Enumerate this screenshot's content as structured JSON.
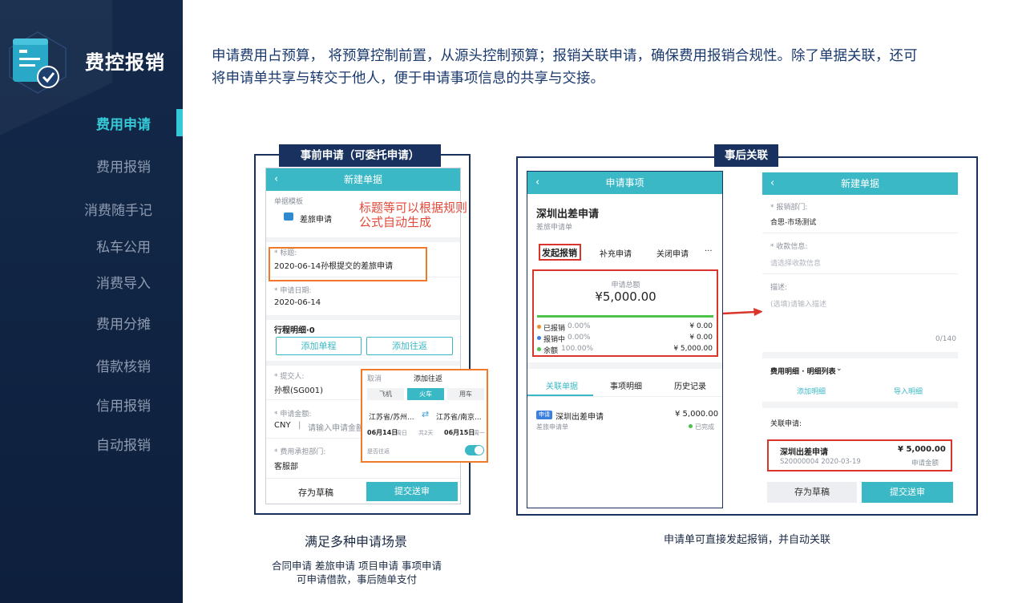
{
  "sidebar": {
    "brand": "费控报销",
    "items": [
      {
        "label": "费用申请",
        "active": true
      },
      {
        "label": "费用报销",
        "active": false
      },
      {
        "label": "消费随手记",
        "active": false
      },
      {
        "label": "私车公用",
        "active": false
      },
      {
        "label": "消费导入",
        "active": false
      },
      {
        "label": "费用分摊",
        "active": false
      },
      {
        "label": "借款核销",
        "active": false
      },
      {
        "label": "信用报销",
        "active": false
      },
      {
        "label": "自动报销",
        "active": false
      }
    ]
  },
  "description": "申请费用占预算， 将预算控制前置，从源头控制预算；报销关联申请，确保费用报销合规性。除了单据关联，还可将申请单共享与转交于他人，便于申请事项信息的共享与交接。",
  "colors": {
    "accent": "#35c8d6",
    "navy": "#18315e",
    "highlight_red": "#d9352b",
    "highlight_orange": "#f07a2a"
  },
  "left_panel": {
    "tag": "事前申请（可委托申请）",
    "annotation": [
      "标题等可以根据规则",
      "公式自动生成"
    ],
    "phone": {
      "header": "新建单据",
      "template_label": "单据模板",
      "template_value": "差旅申请",
      "title_label": "* 标题:",
      "title_value": "2020-06-14孙根提交的差旅申请",
      "date_label": "* 申请日期:",
      "date_value": "2020-06-14",
      "trip_label": "行程明细·0",
      "add_single": "添加单程",
      "add_return": "添加往返",
      "submitter_label": "* 提交人:",
      "submitter_value": "孙根(SG001)",
      "amount_label": "* 申请金额:",
      "currency": "CNY",
      "amount_placeholder": "请输入申请金额",
      "dept_label": "* 费用承担部门:",
      "dept_value": "客服部",
      "save_draft": "存为草稿",
      "submit": "提交送审"
    },
    "popup": {
      "cancel": "取消",
      "title": "添加往返",
      "modes": [
        "飞机",
        "火车",
        "用车"
      ],
      "active_mode": "火车",
      "from": "江苏省/苏州...",
      "swap": "⇄",
      "to": "江苏省/南京...",
      "depart_date": "06月14日",
      "depart_week": "周日",
      "duration": "共2天",
      "return_date": "06月15日",
      "return_week": "周一",
      "round_trip_label": "是否往返"
    },
    "caption": "满足多种申请场景",
    "sub_caption_1": "合同申请  差旅申请  项目申请  事项申请",
    "sub_caption_2": "可申请借款，事后随单支付"
  },
  "right_panel": {
    "tag": "事后关联",
    "phone1": {
      "header": "申请事项",
      "title": "深圳出差申请",
      "subtitle": "差旅申请单",
      "actions": [
        "发起报销",
        "补充申请",
        "关闭申请",
        "···"
      ],
      "total_label": "申请总额",
      "total_value": "¥5,000.00",
      "progress": 1.0,
      "stats": [
        {
          "label": "已报销",
          "pct": "0.00%",
          "value": "¥ 0.00",
          "color": "#f08a2a"
        },
        {
          "label": "报销中",
          "pct": "0.00%",
          "value": "¥ 0.00",
          "color": "#3a7ee0"
        },
        {
          "label": "余额",
          "pct": "100.00%",
          "value": "¥ 5,000.00",
          "color": "#4cc24a"
        }
      ],
      "tabs": [
        "关联单据",
        "事项明细",
        "历史记录"
      ],
      "item_badge": "申请",
      "item_title": "深圳出差申请",
      "item_sub": "差旅申请单",
      "item_amount": "¥ 5,000.00",
      "item_status": "已完成"
    },
    "phone2": {
      "header": "新建单据",
      "dept_label": "* 报销部门:",
      "dept_value": "合思-市场测试",
      "payee_label": "* 收款信息:",
      "payee_placeholder": "请选择收款信息",
      "desc_label": "描述:",
      "desc_placeholder": "(选填)请输入描述",
      "counter": "0/140",
      "detail_label": "费用明细 · 明细列表",
      "add_detail": "添加明细",
      "import_detail": "导入明细",
      "linked_label": "关联申请:",
      "linked_title": "深圳出差申请",
      "linked_amount": "¥ 5,000.00",
      "linked_code": "S20000004  2020-03-19",
      "linked_amount_label": "申请金额",
      "save_draft": "存为草稿",
      "submit": "提交送审"
    },
    "caption": "申请单可直接发起报销，并自动关联"
  }
}
